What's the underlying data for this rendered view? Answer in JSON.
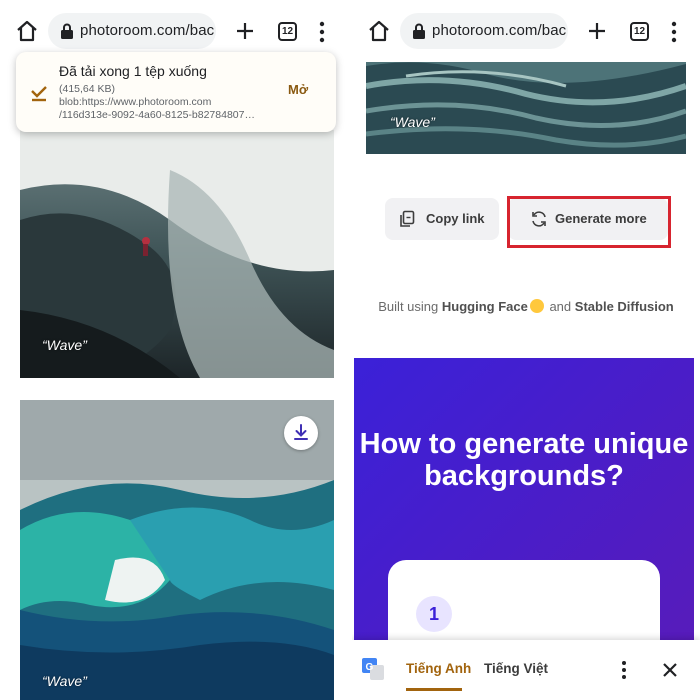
{
  "left": {
    "toolbar": {
      "url": "photoroom.com/bac",
      "tab_count": "12"
    },
    "download": {
      "title": "Đã tải xong 1 tệp xuống",
      "size": "(415,64 KB)",
      "url_line1": "blob:https://www.photoroom.com",
      "url_line2": "/116d313e-9092-4a60-8125-b82784807…",
      "open_label": "Mở"
    },
    "images": [
      {
        "caption": "“Wave”"
      },
      {
        "caption": "“Wave”"
      }
    ]
  },
  "right": {
    "toolbar": {
      "url": "photoroom.com/bac",
      "tab_count": "12"
    },
    "image_caption": "“Wave”",
    "copy_link_label": "Copy link",
    "generate_more_label": "Generate more",
    "credit": {
      "prefix": "Built using",
      "brand1": "Hugging Face",
      "middle": "and",
      "brand2": "Stable Diffusion"
    },
    "promo": {
      "title": "How to generate unique backgrounds?",
      "step_number": "1"
    },
    "translate": {
      "tab_source": "Tiếng Anh",
      "tab_target": "Tiếng Việt"
    }
  },
  "colors": {
    "accent": "#a2640e",
    "promo_bg": "#3b21d8",
    "highlight": "#d7242f"
  }
}
